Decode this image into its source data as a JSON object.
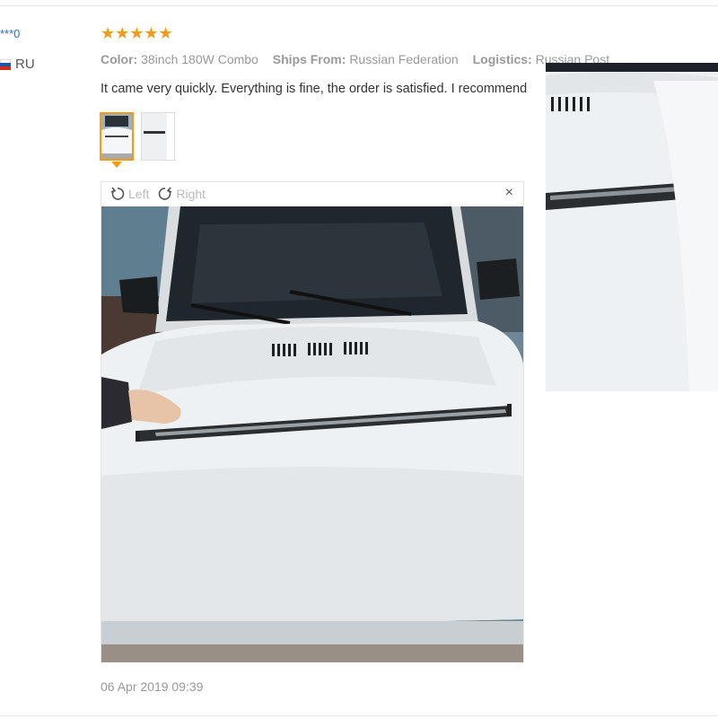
{
  "buyer": {
    "name": "***0",
    "country_code": "RU",
    "flag_colors": [
      "#ffffff",
      "#1c57a5",
      "#d52b1e"
    ]
  },
  "review": {
    "rating": 5,
    "stars": "★★★★★",
    "attributes": [
      {
        "key": "Color:",
        "value": "38inch 180W Combo"
      },
      {
        "key": "Ships From:",
        "value": "Russian Federation"
      },
      {
        "key": "Logistics:",
        "value": "Russian Post"
      }
    ],
    "text": "It came very quickly. Everything is fine, the order is satisfied. I recommend",
    "date": "06 Apr 2019 09:39"
  },
  "viewer": {
    "rotate_left_label": "Left",
    "rotate_right_label": "Right",
    "close_glyph": "×",
    "rotate_left_icon": "rotate-left-icon",
    "rotate_right_icon": "rotate-right-icon"
  },
  "colors": {
    "star": "#f39c12",
    "active_thumb": "#f39c12",
    "link": "#2f6eb5"
  }
}
